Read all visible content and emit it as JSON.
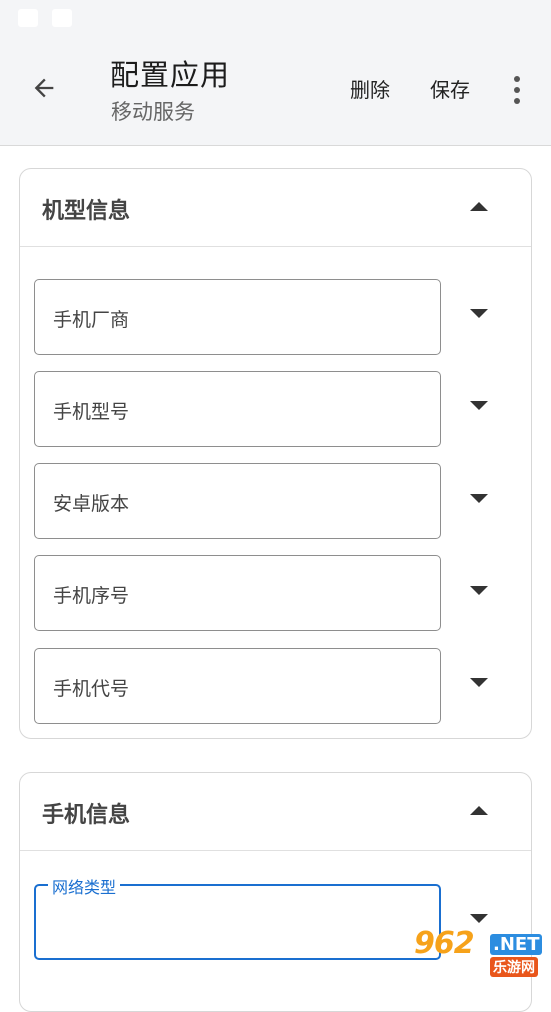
{
  "header": {
    "title": "配置应用",
    "subtitle": "移动服务",
    "actions": {
      "delete": "删除",
      "save": "保存"
    }
  },
  "sections": [
    {
      "title": "机型信息",
      "fields": [
        {
          "label": "手机厂商"
        },
        {
          "label": "手机型号"
        },
        {
          "label": "安卓版本"
        },
        {
          "label": "手机序号"
        },
        {
          "label": "手机代号"
        }
      ]
    },
    {
      "title": "手机信息",
      "fields": [
        {
          "label": "网络类型"
        }
      ]
    }
  ],
  "watermark": {
    "number": "962",
    "domain": ".NET",
    "name": "乐游网"
  },
  "colors": {
    "accent": "#1a6fd0",
    "appbar": "#f4f5f7"
  }
}
